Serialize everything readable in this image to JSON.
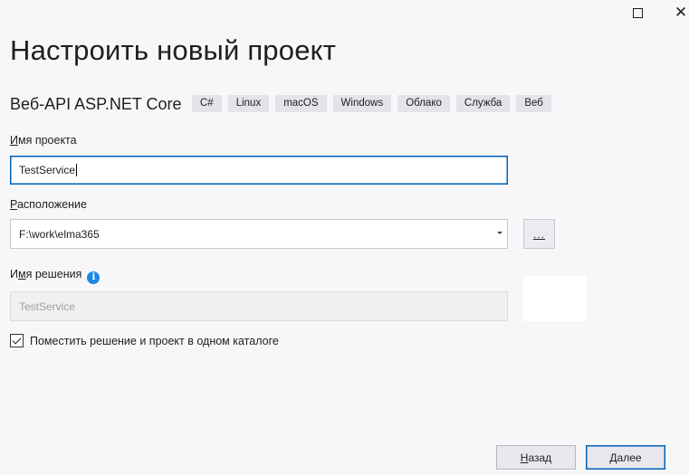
{
  "window": {
    "title": "Настроить новый проект",
    "maximize_icon": "maximize-icon",
    "close_icon": "close-icon"
  },
  "template": {
    "name": "Веб-API ASP.NET Core",
    "tags": [
      "C#",
      "Linux",
      "macOS",
      "Windows",
      "Облако",
      "Служба",
      "Веб"
    ]
  },
  "project_name": {
    "label_accel": "И",
    "label_rest": "мя проекта",
    "value": "TestService"
  },
  "location": {
    "label_accel": "Р",
    "label_rest": "асположение",
    "value": "F:\\work\\elma365",
    "browse_label": "..."
  },
  "solution_name": {
    "label_pre": "И",
    "label_accel": "м",
    "label_rest": "я решения",
    "value": "TestService",
    "info_icon": "info-icon"
  },
  "same_directory": {
    "checked": true,
    "label": "Поместить решение и проект в одном каталоге"
  },
  "buttons": {
    "back_accel": "Н",
    "back_rest": "азад",
    "next_accel": "Д",
    "next_rest": "алее"
  },
  "colors": {
    "accent": "#005fb8",
    "info": "#1e88e5",
    "background": "#f7f7fa"
  }
}
